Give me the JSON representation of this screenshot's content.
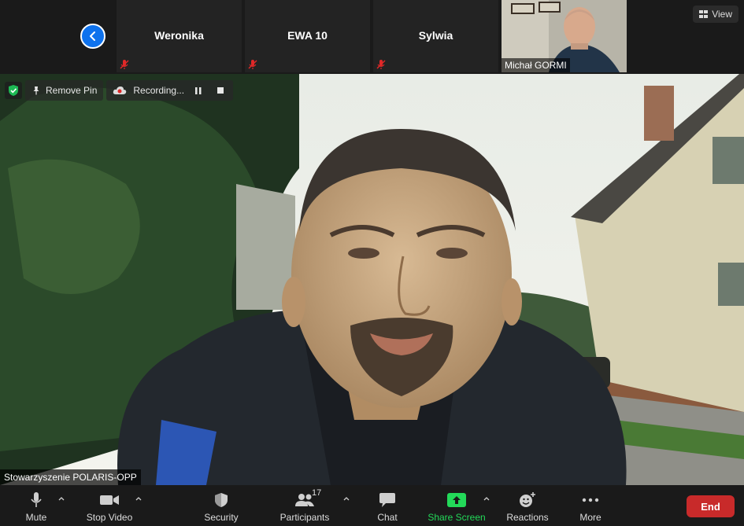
{
  "strip": {
    "back_icon": "chevron-left-icon",
    "participants": [
      {
        "name": "Weronika",
        "muted": true
      },
      {
        "name": "EWA 10",
        "muted": true
      },
      {
        "name": "Sylwia",
        "muted": true
      }
    ],
    "video_tile": {
      "name": "Michał GORMI"
    },
    "view_label": "View"
  },
  "main": {
    "remove_pin_label": "Remove Pin",
    "recording_label": "Recording...",
    "speaker_name": "Stowarzyszenie POLARIS-OPP"
  },
  "toolbar": {
    "mute_label": "Mute",
    "stop_video_label": "Stop Video",
    "security_label": "Security",
    "participants_label": "Participants",
    "participants_count": "17",
    "chat_label": "Chat",
    "share_screen_label": "Share Screen",
    "reactions_label": "Reactions",
    "more_label": "More",
    "end_label": "End"
  },
  "colors": {
    "accent_blue": "#0e72ed",
    "share_green": "#23d959",
    "end_red": "#c82a2a",
    "mute_red": "#e02828",
    "toolbar_bg": "#1a1a1a"
  }
}
